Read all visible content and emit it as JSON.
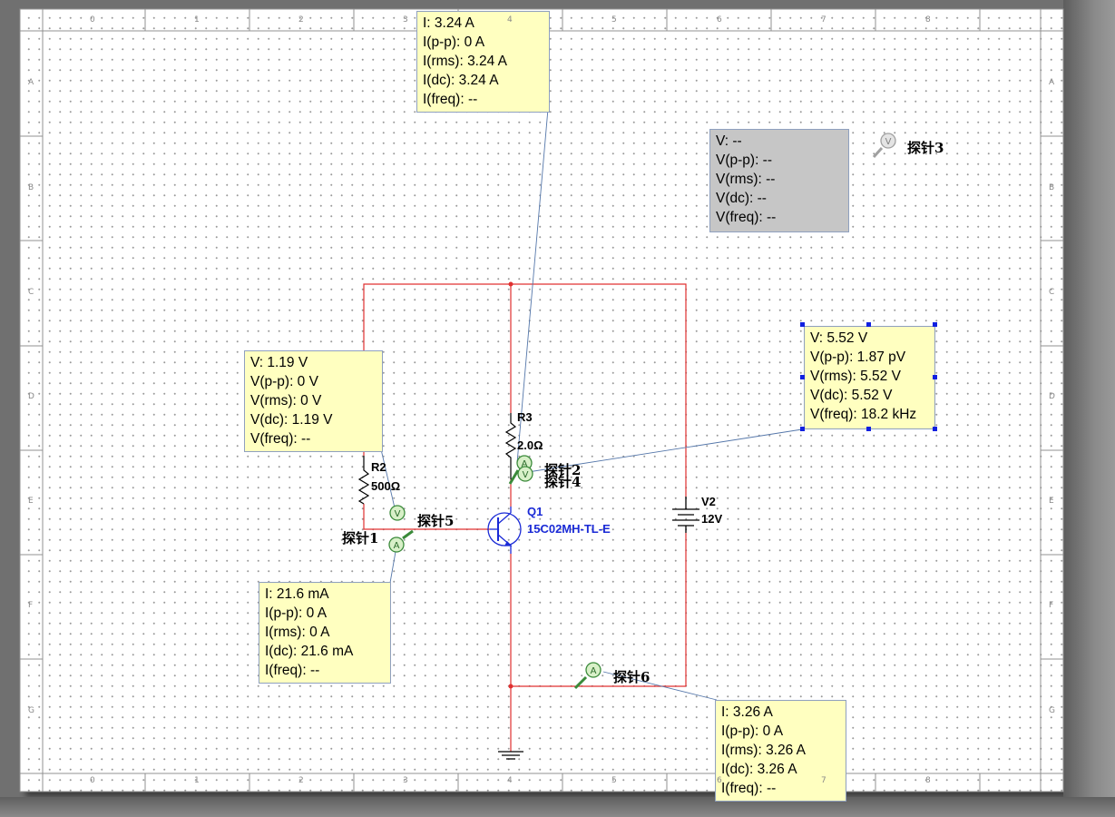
{
  "ruler": {
    "columns": [
      "0",
      "1",
      "2",
      "3",
      "4",
      "5",
      "6",
      "7",
      "8"
    ],
    "rows": [
      "A",
      "B",
      "C",
      "D",
      "E",
      "F",
      "G"
    ]
  },
  "components": {
    "r3": {
      "name": "R3",
      "value": "2.0Ω"
    },
    "r2": {
      "name": "R2",
      "value": "500Ω"
    },
    "q1": {
      "name": "Q1",
      "value": "15C02MH-TL-E"
    },
    "v2": {
      "name": "V2",
      "value": "12V"
    }
  },
  "probes": {
    "probe1": {
      "tag": "探针1",
      "type": "A"
    },
    "probe2": {
      "tag": "探针2",
      "type": "A"
    },
    "probe3": {
      "tag": "探针3",
      "type": "V"
    },
    "probe4": {
      "tag": "探针4",
      "type": "V"
    },
    "probe5": {
      "tag": "探针5",
      "type": "V"
    },
    "probe6": {
      "tag": "探针6",
      "type": "A"
    }
  },
  "boxes": {
    "top": {
      "lines": [
        "I: 3.24 A",
        "I(p-p): 0 A",
        "I(rms): 3.24 A",
        "I(dc): 3.24 A",
        "I(freq): --"
      ]
    },
    "probe3": {
      "lines": [
        "V: --",
        "V(p-p): --",
        "V(rms): --",
        "V(dc): --",
        "V(freq): --"
      ]
    },
    "right": {
      "lines": [
        "V: 5.52 V",
        "V(p-p): 1.87 pV",
        "V(rms): 5.52 V",
        "V(dc): 5.52 V",
        "V(freq): 18.2 kHz"
      ]
    },
    "left": {
      "lines": [
        "V: 1.19 V",
        "V(p-p): 0 V",
        "V(rms): 0 V",
        "V(dc): 1.19 V",
        "V(freq): --"
      ]
    },
    "bottomleft": {
      "lines": [
        "I: 21.6 mA",
        "I(p-p): 0 A",
        "I(rms): 0 A",
        "I(dc): 21.6 mA",
        "I(freq): --"
      ]
    },
    "bottomright": {
      "lines": [
        "I: 3.26 A",
        "I(p-p): 0 A",
        "I(rms): 3.26 A",
        "I(dc): 3.26 A",
        "I(freq): --"
      ]
    }
  },
  "colors": {
    "wire": "#e03030",
    "probe_box": "#ffffc0",
    "probe_box_inactive": "#c6c6c6",
    "component_blue": "#1a2ad6",
    "leader": "#5577aa"
  }
}
